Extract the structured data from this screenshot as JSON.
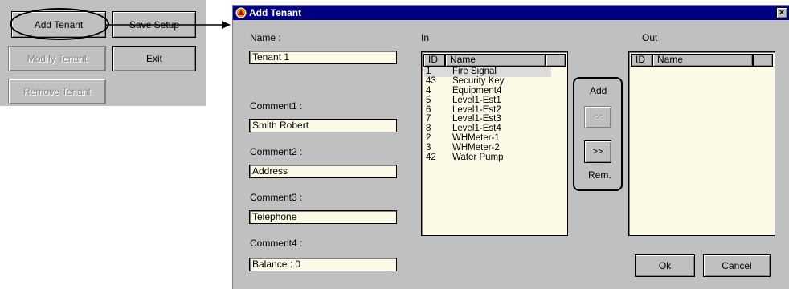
{
  "main_panel": {
    "add_tenant": "Add Tenant",
    "save_setup": "Save Setup",
    "modify_tenant": "Modify Tenant",
    "exit": "Exit",
    "remove_tenant": "Remove Tenant"
  },
  "dialog": {
    "title": "Add Tenant",
    "close": "×",
    "name_label": "Name :",
    "name_value": "Tenant 1",
    "comment1_label": "Comment1 :",
    "comment1_value": "Smith Robert",
    "comment2_label": "Comment2 :",
    "comment2_value": "Address",
    "comment3_label": "Comment3 :",
    "comment3_value": "Telephone",
    "comment4_label": "Comment4 :",
    "comment4_value": "Balance : 0",
    "in_label": "In",
    "out_label": "Out",
    "col_id": "ID",
    "col_name": "Name",
    "in_list": [
      {
        "id": "1",
        "name": "Fire Signal"
      },
      {
        "id": "43",
        "name": "Security Key"
      },
      {
        "id": "4",
        "name": "Equipment4"
      },
      {
        "id": "5",
        "name": "Level1-Est1"
      },
      {
        "id": "6",
        "name": "Level1-Est2"
      },
      {
        "id": "7",
        "name": "Level1-Est3"
      },
      {
        "id": "8",
        "name": "Level1-Est4"
      },
      {
        "id": "2",
        "name": "WHMeter-1"
      },
      {
        "id": "3",
        "name": "WHMeter-2"
      },
      {
        "id": "42",
        "name": "Water Pump"
      }
    ],
    "add_label": "Add",
    "move_left": "<<",
    "move_right": ">>",
    "rem_label": "Rem.",
    "ok": "Ok",
    "cancel": "Cancel"
  },
  "colors": {
    "title_bar": "#000080",
    "window_face": "#c0c0c0",
    "field_bg": "#fcfae6",
    "selected_row": "#dcdcdc"
  }
}
